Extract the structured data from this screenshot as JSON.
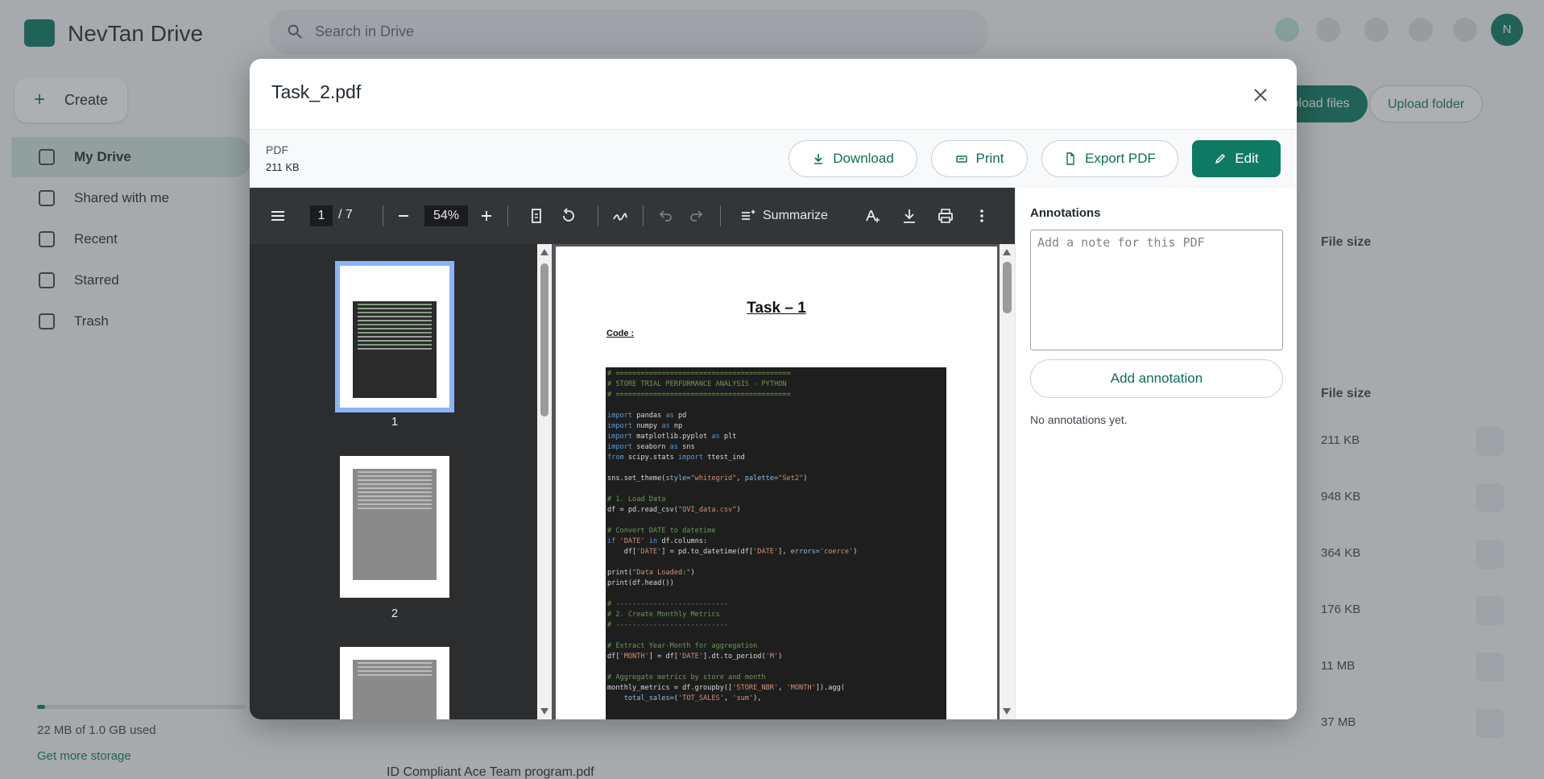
{
  "background": {
    "app_name": "NevTan Drive",
    "search_placeholder": "Search in Drive",
    "avatar_initials": "N",
    "create_label": "Create",
    "nav": [
      {
        "label": "My Drive"
      },
      {
        "label": "Shared with me"
      },
      {
        "label": "Recent"
      },
      {
        "label": "Starred"
      },
      {
        "label": "Trash"
      }
    ],
    "storage_text": "22 MB of 1.0 GB used",
    "storage_link": "Get more storage",
    "upload_files": "Upload files",
    "upload_folder": "Upload folder",
    "col_file_size": "File size",
    "rows": [
      {
        "size": "211 KB"
      },
      {
        "size": "948 KB"
      },
      {
        "size": "364 KB"
      },
      {
        "size": "176 KB"
      },
      {
        "size": "11 MB"
      },
      {
        "size": "37 MB"
      }
    ],
    "last_row_name": "ID Compliant Ace Team program.pdf"
  },
  "modal": {
    "title": "Task_2.pdf",
    "file_type": "PDF",
    "file_size": "211 KB",
    "buttons": {
      "download": "Download",
      "print": "Print",
      "export": "Export PDF",
      "edit": "Edit"
    }
  },
  "viewer": {
    "current_page": "1",
    "total_pages": "/  7",
    "zoom": "54%",
    "summarize_label": "Summarize",
    "thumbnails": [
      {
        "num": "1"
      },
      {
        "num": "2"
      }
    ],
    "page": {
      "title": "Task – 1",
      "code_label": "Code :"
    }
  },
  "annotations": {
    "title": "Annotations",
    "placeholder": "Add a note for this PDF",
    "add_button": "Add annotation",
    "empty_text": "No annotations yet."
  },
  "colors": {
    "accent": "#0f7a64",
    "viewer_toolbar": "#333639",
    "thumb_selected": "#8ab4f8"
  }
}
